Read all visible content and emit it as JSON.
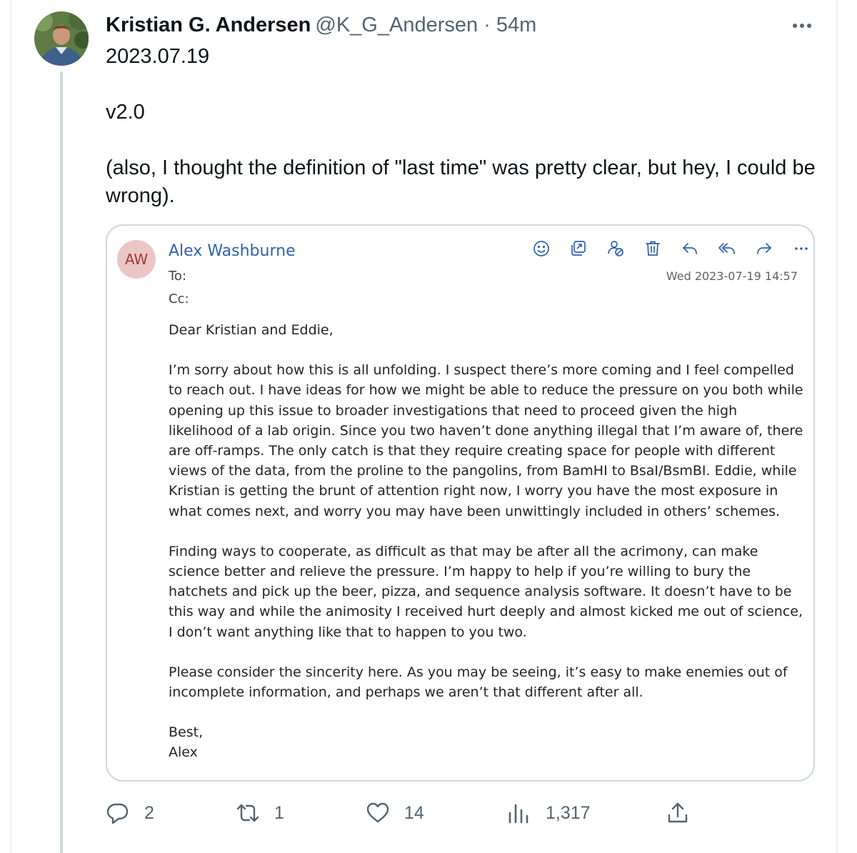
{
  "tweet": {
    "author_name": "Kristian G. Andersen",
    "author_handle": "@K_G_Andersen",
    "separator": " · ",
    "time": "54m",
    "text_lines": [
      "2023.07.19",
      "v2.0",
      "(also, I thought the definition of \"last time\" was pretty clear, but hey, I could be wrong)."
    ]
  },
  "email": {
    "avatar_initials": "AW",
    "sender": "Alex Washburne",
    "to_label": "To:",
    "cc_label": "Cc:",
    "date": "Wed 2023-07-19 14:57",
    "toolbar_icons": [
      "emoji-icon",
      "immersive-reader-icon",
      "permissions-icon",
      "delete-icon",
      "reply-icon",
      "reply-all-icon",
      "forward-icon",
      "more-actions-icon"
    ],
    "greeting": "Dear Kristian and Eddie,",
    "paragraphs": [
      "I’m sorry about how this is all unfolding. I suspect there’s more coming and I feel compelled to reach out. I have ideas for how we might be able to reduce the pressure on you both while opening up this issue to broader investigations that need to proceed given the high likelihood of a lab origin. Since you two haven’t done anything illegal that I’m aware of, there are off-ramps. The only catch is that they require creating space for people with different views of the data, from the proline to the pangolins, from BamHI to BsaI/BsmBI. Eddie, while Kristian is getting the brunt of attention right now, I worry you have the most exposure in what comes next, and worry you may have been unwittingly included in others’ schemes.",
      "Finding ways to cooperate, as difficult as that may be after all the acrimony, can make science better and relieve the pressure. I’m happy to help if you’re willing to bury the hatchets and pick up the beer, pizza, and sequence analysis software. It doesn’t have to be this way and while the animosity I received hurt deeply and almost kicked me out of science, I don’t want anything like that to happen to you two.",
      "Please consider the sincerity here. As you may be seeing, it’s easy to make enemies out of incomplete information, and perhaps we aren’t that different after all."
    ],
    "signoff": "Best,",
    "signature": "Alex"
  },
  "actions": {
    "replies": "2",
    "retweets": "1",
    "likes": "14",
    "views": "1,317"
  },
  "colors": {
    "accent_link": "#2f61b0",
    "avatar_bg": "#ebc6c7",
    "avatar_text": "#a4373a",
    "muted_text": "#536471"
  }
}
